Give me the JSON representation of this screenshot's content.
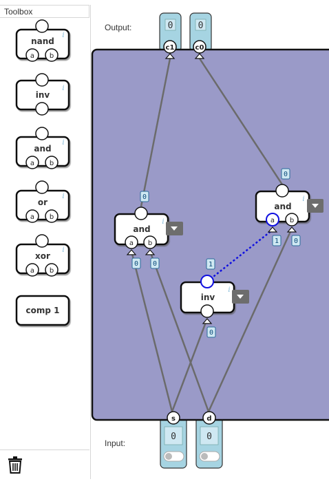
{
  "toolbox": {
    "title": "Toolbox",
    "items": [
      {
        "label": "nand",
        "inputs": [
          "a",
          "b"
        ]
      },
      {
        "label": "inv",
        "inputs": []
      },
      {
        "label": "and",
        "inputs": [
          "a",
          "b"
        ]
      },
      {
        "label": "or",
        "inputs": [
          "a",
          "b"
        ]
      },
      {
        "label": "xor",
        "inputs": [
          "a",
          "b"
        ]
      },
      {
        "label": "comp 1",
        "inputs": []
      }
    ],
    "info_glyph": "i",
    "trash_icon": "trash-icon"
  },
  "board": {
    "output_label": "Output:",
    "input_label": "Input:",
    "outputs": [
      {
        "name": "c1",
        "value": "0"
      },
      {
        "name": "c0",
        "value": "0"
      }
    ],
    "inputs": [
      {
        "name": "s",
        "value": "0",
        "toggle_on": false
      },
      {
        "name": "d",
        "value": "0",
        "toggle_on": false
      }
    ],
    "gates": [
      {
        "id": "and-left",
        "label": "and",
        "pins": [
          "a",
          "b"
        ],
        "out_value": "0",
        "in_values": [
          "0",
          "0"
        ]
      },
      {
        "id": "and-right",
        "label": "and",
        "pins": [
          "a",
          "b"
        ],
        "out_value": "0",
        "in_values": [
          "1",
          "0"
        ]
      },
      {
        "id": "inv-center",
        "label": "inv",
        "pins": [],
        "out_value": "1",
        "in_values": [
          "0"
        ]
      }
    ],
    "colors": {
      "board_fill": "#9a9ac8",
      "wire": "#6b6b6b",
      "active_wire": "#1010e0",
      "io_fill": "#a6d4e2",
      "value_fill": "#cfe8f2"
    }
  }
}
